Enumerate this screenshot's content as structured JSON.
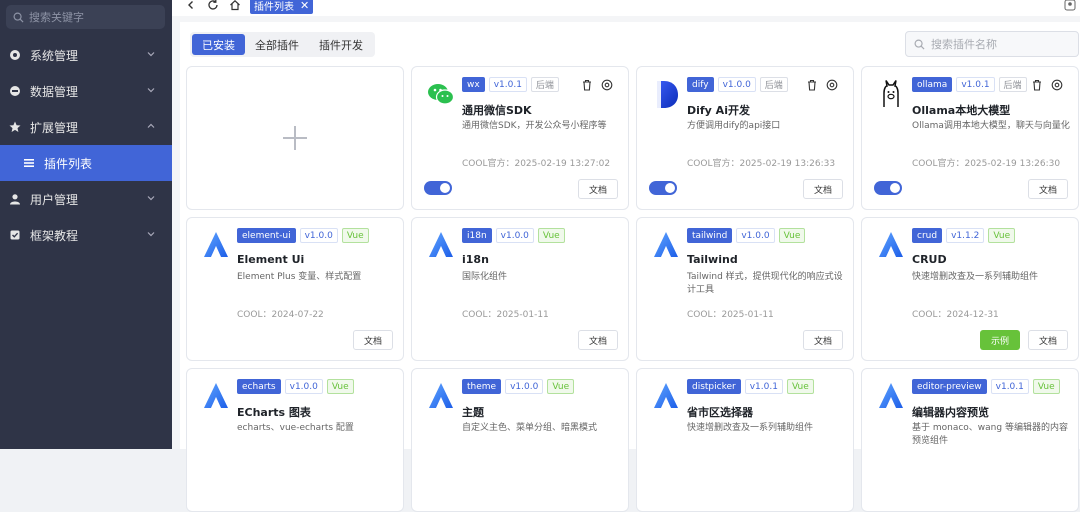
{
  "sidebar": {
    "search_placeholder": "搜索关键字",
    "items": [
      {
        "label": "系统管理",
        "icon": "settings-icon"
      },
      {
        "label": "数据管理",
        "icon": "data-icon"
      },
      {
        "label": "扩展管理",
        "icon": "star-icon"
      },
      {
        "label": "插件列表",
        "icon": "list-icon"
      },
      {
        "label": "用户管理",
        "icon": "user-icon"
      },
      {
        "label": "框架教程",
        "icon": "book-icon"
      }
    ]
  },
  "topbar": {
    "active_tab": "插件列表",
    "close_symbol": "✕"
  },
  "tabs": [
    "已安装",
    "全部插件",
    "插件开发"
  ],
  "plugin_search_placeholder": "搜索插件名称",
  "add_symbol": "+",
  "buttons": {
    "doc": "文档",
    "demo": "示例"
  },
  "colors": {
    "accent": "#4165d7",
    "sidebar": "#2f3447",
    "green": "#67c23a"
  },
  "cards": [
    {
      "key": "wx",
      "version": "v1.0.1",
      "tag": "后端",
      "title": "通用微信SDK",
      "desc": "通用微信SDK，开发公众号小程序等",
      "meta": "COOL官方：2025-02-19 13:27:02",
      "logo": "wechat-logo"
    },
    {
      "key": "dify",
      "version": "v1.0.0",
      "tag": "后端",
      "title": "Dify Ai开发",
      "desc": "方便调用dify的api接口",
      "meta": "COOL官方：2025-02-19 13:26:33",
      "logo": "dify-logo"
    },
    {
      "key": "ollama",
      "version": "v1.0.1",
      "tag": "后端",
      "title": "Ollama本地大模型",
      "desc": "Ollama调用本地大模型，聊天与向量化",
      "meta": "COOL官方：2025-02-19 13:26:30",
      "logo": "ollama-logo"
    },
    {
      "key": "element-ui",
      "version": "v1.0.0",
      "tag": "Vue",
      "title": "Element Ui",
      "desc": "Element Plus 变量、样式配置",
      "meta": "COOL：2024-07-22",
      "logo": "cool-logo"
    },
    {
      "key": "i18n",
      "version": "v1.0.0",
      "tag": "Vue",
      "title": "i18n",
      "desc": "国际化组件",
      "meta": "COOL：2025-01-11",
      "logo": "cool-logo"
    },
    {
      "key": "tailwind",
      "version": "v1.0.0",
      "tag": "Vue",
      "title": "Tailwind",
      "desc": "Tailwind 样式，提供现代化的响应式设计工具",
      "meta": "COOL：2025-01-11",
      "logo": "cool-logo"
    },
    {
      "key": "crud",
      "version": "v1.1.2",
      "tag": "Vue",
      "title": "CRUD",
      "desc": "快速增删改查及一系列辅助组件",
      "meta": "COOL：2024-12-31",
      "logo": "cool-logo"
    },
    {
      "key": "echarts",
      "version": "v1.0.0",
      "tag": "Vue",
      "title": "ECharts 图表",
      "desc": "echarts、vue-echarts 配置",
      "meta": "",
      "logo": "cool-logo"
    },
    {
      "key": "theme",
      "version": "v1.0.0",
      "tag": "Vue",
      "title": "主题",
      "desc": "自定义主色、菜单分组、暗黑模式",
      "meta": "",
      "logo": "cool-logo"
    },
    {
      "key": "distpicker",
      "version": "v1.0.1",
      "tag": "Vue",
      "title": "省市区选择器",
      "desc": "快速增删改查及一系列辅助组件",
      "meta": "",
      "logo": "cool-logo"
    },
    {
      "key": "editor-preview",
      "version": "v1.0.1",
      "tag": "Vue",
      "title": "编辑器内容预览",
      "desc": "基于 monaco、wang 等编辑器的内容预览组件",
      "meta": "",
      "logo": "cool-logo"
    }
  ]
}
